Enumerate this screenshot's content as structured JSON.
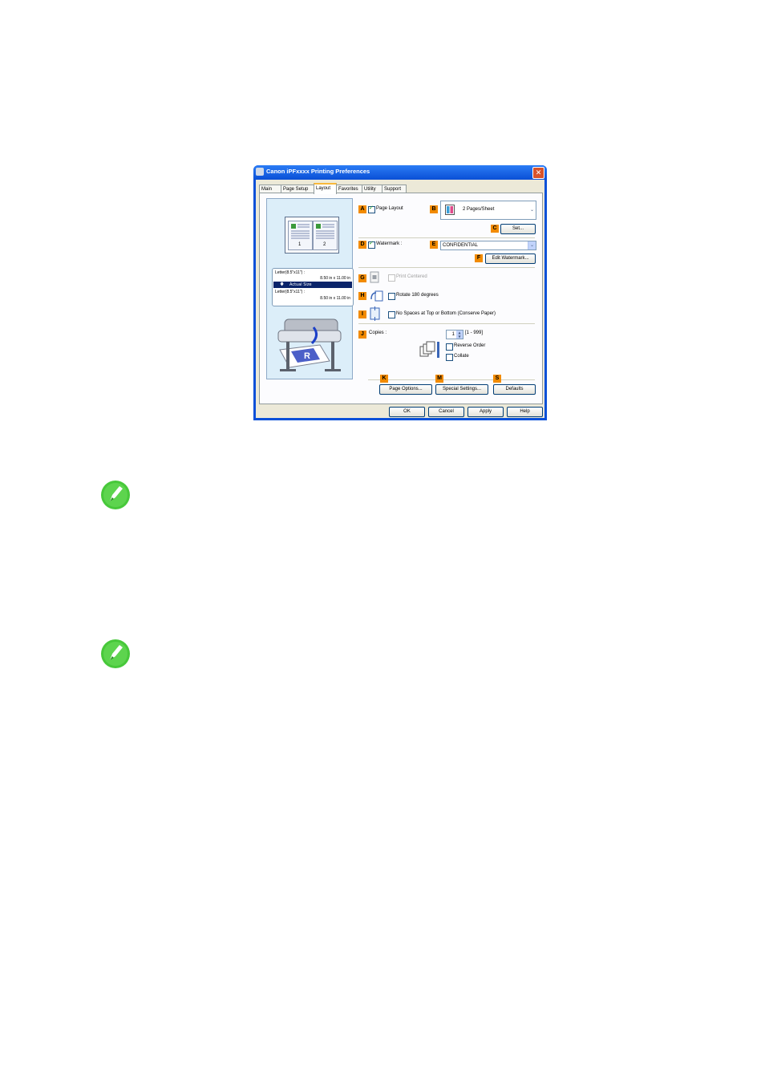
{
  "dialog": {
    "title": "Canon iPFxxxx Printing Preferences",
    "close_glyph": "✕",
    "tabs": [
      "Main",
      "Page Setup",
      "Layout",
      "Favorites",
      "Utility",
      "Support"
    ],
    "active_tab": "Layout",
    "preview": {
      "page_nums": [
        "1",
        "2"
      ],
      "line1": "Letter(8.5\"x11\") :",
      "line2": "8.50 in x 11.00 in",
      "selected": "Actual Size",
      "arrow": "🡇",
      "line3": "Letter(8.5\"x11\") :",
      "line4": "8.50 in x 11.00 in"
    },
    "labels": {
      "A": "A",
      "B": "B",
      "C": "C",
      "D": "D",
      "E": "E",
      "F": "F",
      "G": "G",
      "H": "H",
      "I": "I",
      "J": "J",
      "K": "K",
      "M": "M",
      "S": "S"
    },
    "page_layout": {
      "label": "Page Layout",
      "checked": true,
      "value": "2 Pages/Sheet",
      "set_button": "Set..."
    },
    "watermark": {
      "label": "Watermark :",
      "checked": true,
      "value": "CONFIDENTIAL",
      "edit_button": "Edit Watermark..."
    },
    "print_centered": {
      "label": "Print Centered",
      "enabled": false
    },
    "rotate": {
      "label": "Rotate 180 degrees"
    },
    "no_spaces": {
      "label": "No Spaces at Top or Bottom (Conserve Paper)"
    },
    "copies": {
      "label": "Copies :",
      "value": "1",
      "range": "[1 - 999]",
      "reverse_order": "Reverse Order",
      "collate": "Collate"
    },
    "buttons": {
      "page_options": "Page Options...",
      "special_settings": "Special Settings...",
      "defaults": "Defaults"
    },
    "footer": {
      "ok": "OK",
      "cancel": "Cancel",
      "apply": "Apply",
      "help": "Help"
    }
  },
  "colors": {
    "label_bg": "#f28b00",
    "titlebar": "#0a4fd6",
    "note_green": "#47c83a"
  }
}
